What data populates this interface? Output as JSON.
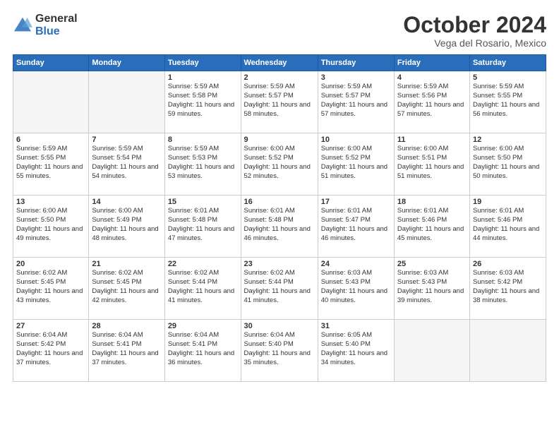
{
  "logo": {
    "general": "General",
    "blue": "Blue"
  },
  "header": {
    "month": "October 2024",
    "location": "Vega del Rosario, Mexico"
  },
  "weekdays": [
    "Sunday",
    "Monday",
    "Tuesday",
    "Wednesday",
    "Thursday",
    "Friday",
    "Saturday"
  ],
  "weeks": [
    [
      {
        "day": "",
        "sunrise": "",
        "sunset": "",
        "daylight": ""
      },
      {
        "day": "",
        "sunrise": "",
        "sunset": "",
        "daylight": ""
      },
      {
        "day": "1",
        "sunrise": "Sunrise: 5:59 AM",
        "sunset": "Sunset: 5:58 PM",
        "daylight": "Daylight: 11 hours and 59 minutes."
      },
      {
        "day": "2",
        "sunrise": "Sunrise: 5:59 AM",
        "sunset": "Sunset: 5:57 PM",
        "daylight": "Daylight: 11 hours and 58 minutes."
      },
      {
        "day": "3",
        "sunrise": "Sunrise: 5:59 AM",
        "sunset": "Sunset: 5:57 PM",
        "daylight": "Daylight: 11 hours and 57 minutes."
      },
      {
        "day": "4",
        "sunrise": "Sunrise: 5:59 AM",
        "sunset": "Sunset: 5:56 PM",
        "daylight": "Daylight: 11 hours and 57 minutes."
      },
      {
        "day": "5",
        "sunrise": "Sunrise: 5:59 AM",
        "sunset": "Sunset: 5:55 PM",
        "daylight": "Daylight: 11 hours and 56 minutes."
      }
    ],
    [
      {
        "day": "6",
        "sunrise": "Sunrise: 5:59 AM",
        "sunset": "Sunset: 5:55 PM",
        "daylight": "Daylight: 11 hours and 55 minutes."
      },
      {
        "day": "7",
        "sunrise": "Sunrise: 5:59 AM",
        "sunset": "Sunset: 5:54 PM",
        "daylight": "Daylight: 11 hours and 54 minutes."
      },
      {
        "day": "8",
        "sunrise": "Sunrise: 5:59 AM",
        "sunset": "Sunset: 5:53 PM",
        "daylight": "Daylight: 11 hours and 53 minutes."
      },
      {
        "day": "9",
        "sunrise": "Sunrise: 6:00 AM",
        "sunset": "Sunset: 5:52 PM",
        "daylight": "Daylight: 11 hours and 52 minutes."
      },
      {
        "day": "10",
        "sunrise": "Sunrise: 6:00 AM",
        "sunset": "Sunset: 5:52 PM",
        "daylight": "Daylight: 11 hours and 51 minutes."
      },
      {
        "day": "11",
        "sunrise": "Sunrise: 6:00 AM",
        "sunset": "Sunset: 5:51 PM",
        "daylight": "Daylight: 11 hours and 51 minutes."
      },
      {
        "day": "12",
        "sunrise": "Sunrise: 6:00 AM",
        "sunset": "Sunset: 5:50 PM",
        "daylight": "Daylight: 11 hours and 50 minutes."
      }
    ],
    [
      {
        "day": "13",
        "sunrise": "Sunrise: 6:00 AM",
        "sunset": "Sunset: 5:50 PM",
        "daylight": "Daylight: 11 hours and 49 minutes."
      },
      {
        "day": "14",
        "sunrise": "Sunrise: 6:00 AM",
        "sunset": "Sunset: 5:49 PM",
        "daylight": "Daylight: 11 hours and 48 minutes."
      },
      {
        "day": "15",
        "sunrise": "Sunrise: 6:01 AM",
        "sunset": "Sunset: 5:48 PM",
        "daylight": "Daylight: 11 hours and 47 minutes."
      },
      {
        "day": "16",
        "sunrise": "Sunrise: 6:01 AM",
        "sunset": "Sunset: 5:48 PM",
        "daylight": "Daylight: 11 hours and 46 minutes."
      },
      {
        "day": "17",
        "sunrise": "Sunrise: 6:01 AM",
        "sunset": "Sunset: 5:47 PM",
        "daylight": "Daylight: 11 hours and 46 minutes."
      },
      {
        "day": "18",
        "sunrise": "Sunrise: 6:01 AM",
        "sunset": "Sunset: 5:46 PM",
        "daylight": "Daylight: 11 hours and 45 minutes."
      },
      {
        "day": "19",
        "sunrise": "Sunrise: 6:01 AM",
        "sunset": "Sunset: 5:46 PM",
        "daylight": "Daylight: 11 hours and 44 minutes."
      }
    ],
    [
      {
        "day": "20",
        "sunrise": "Sunrise: 6:02 AM",
        "sunset": "Sunset: 5:45 PM",
        "daylight": "Daylight: 11 hours and 43 minutes."
      },
      {
        "day": "21",
        "sunrise": "Sunrise: 6:02 AM",
        "sunset": "Sunset: 5:45 PM",
        "daylight": "Daylight: 11 hours and 42 minutes."
      },
      {
        "day": "22",
        "sunrise": "Sunrise: 6:02 AM",
        "sunset": "Sunset: 5:44 PM",
        "daylight": "Daylight: 11 hours and 41 minutes."
      },
      {
        "day": "23",
        "sunrise": "Sunrise: 6:02 AM",
        "sunset": "Sunset: 5:44 PM",
        "daylight": "Daylight: 11 hours and 41 minutes."
      },
      {
        "day": "24",
        "sunrise": "Sunrise: 6:03 AM",
        "sunset": "Sunset: 5:43 PM",
        "daylight": "Daylight: 11 hours and 40 minutes."
      },
      {
        "day": "25",
        "sunrise": "Sunrise: 6:03 AM",
        "sunset": "Sunset: 5:43 PM",
        "daylight": "Daylight: 11 hours and 39 minutes."
      },
      {
        "day": "26",
        "sunrise": "Sunrise: 6:03 AM",
        "sunset": "Sunset: 5:42 PM",
        "daylight": "Daylight: 11 hours and 38 minutes."
      }
    ],
    [
      {
        "day": "27",
        "sunrise": "Sunrise: 6:04 AM",
        "sunset": "Sunset: 5:42 PM",
        "daylight": "Daylight: 11 hours and 37 minutes."
      },
      {
        "day": "28",
        "sunrise": "Sunrise: 6:04 AM",
        "sunset": "Sunset: 5:41 PM",
        "daylight": "Daylight: 11 hours and 37 minutes."
      },
      {
        "day": "29",
        "sunrise": "Sunrise: 6:04 AM",
        "sunset": "Sunset: 5:41 PM",
        "daylight": "Daylight: 11 hours and 36 minutes."
      },
      {
        "day": "30",
        "sunrise": "Sunrise: 6:04 AM",
        "sunset": "Sunset: 5:40 PM",
        "daylight": "Daylight: 11 hours and 35 minutes."
      },
      {
        "day": "31",
        "sunrise": "Sunrise: 6:05 AM",
        "sunset": "Sunset: 5:40 PM",
        "daylight": "Daylight: 11 hours and 34 minutes."
      },
      {
        "day": "",
        "sunrise": "",
        "sunset": "",
        "daylight": ""
      },
      {
        "day": "",
        "sunrise": "",
        "sunset": "",
        "daylight": ""
      }
    ]
  ]
}
